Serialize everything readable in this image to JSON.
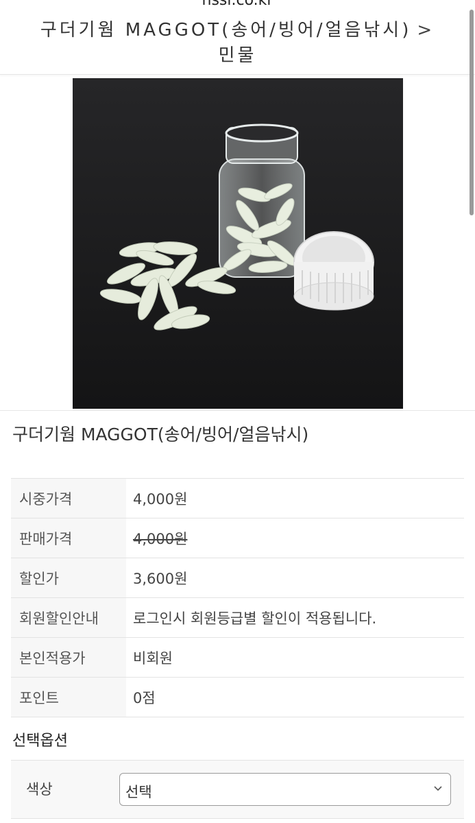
{
  "browser": {
    "url_fragment": "nssi.co.kr"
  },
  "header": {
    "breadcrumb_current": "구더기웜 MAGGOT(송어/빙어/얼음낚시)",
    "breadcrumb_separator": ">",
    "breadcrumb_category": "민물"
  },
  "product": {
    "title": "구더기웜 MAGGOT(송어/빙어/얼음낚시)",
    "image_alt_icon": "product-photo-maggot-jar"
  },
  "info": {
    "rows": [
      {
        "label": "시중가격",
        "value": "4,000원"
      },
      {
        "label": "판매가격",
        "value": "4,000원"
      },
      {
        "label": "할인가",
        "value": "3,600원"
      },
      {
        "label": "회원할인안내",
        "value": "로그인시 회원등급별 할인이 적용됩니다."
      },
      {
        "label": "본인적용가",
        "value": "비회원"
      },
      {
        "label": "포인트",
        "value": "0점"
      }
    ]
  },
  "options": {
    "section_title": "선택옵션",
    "color_label": "색상",
    "color_select_value": "선택"
  },
  "colors": {
    "link": "#1a73c9",
    "image_background": "#1c1c1e"
  }
}
